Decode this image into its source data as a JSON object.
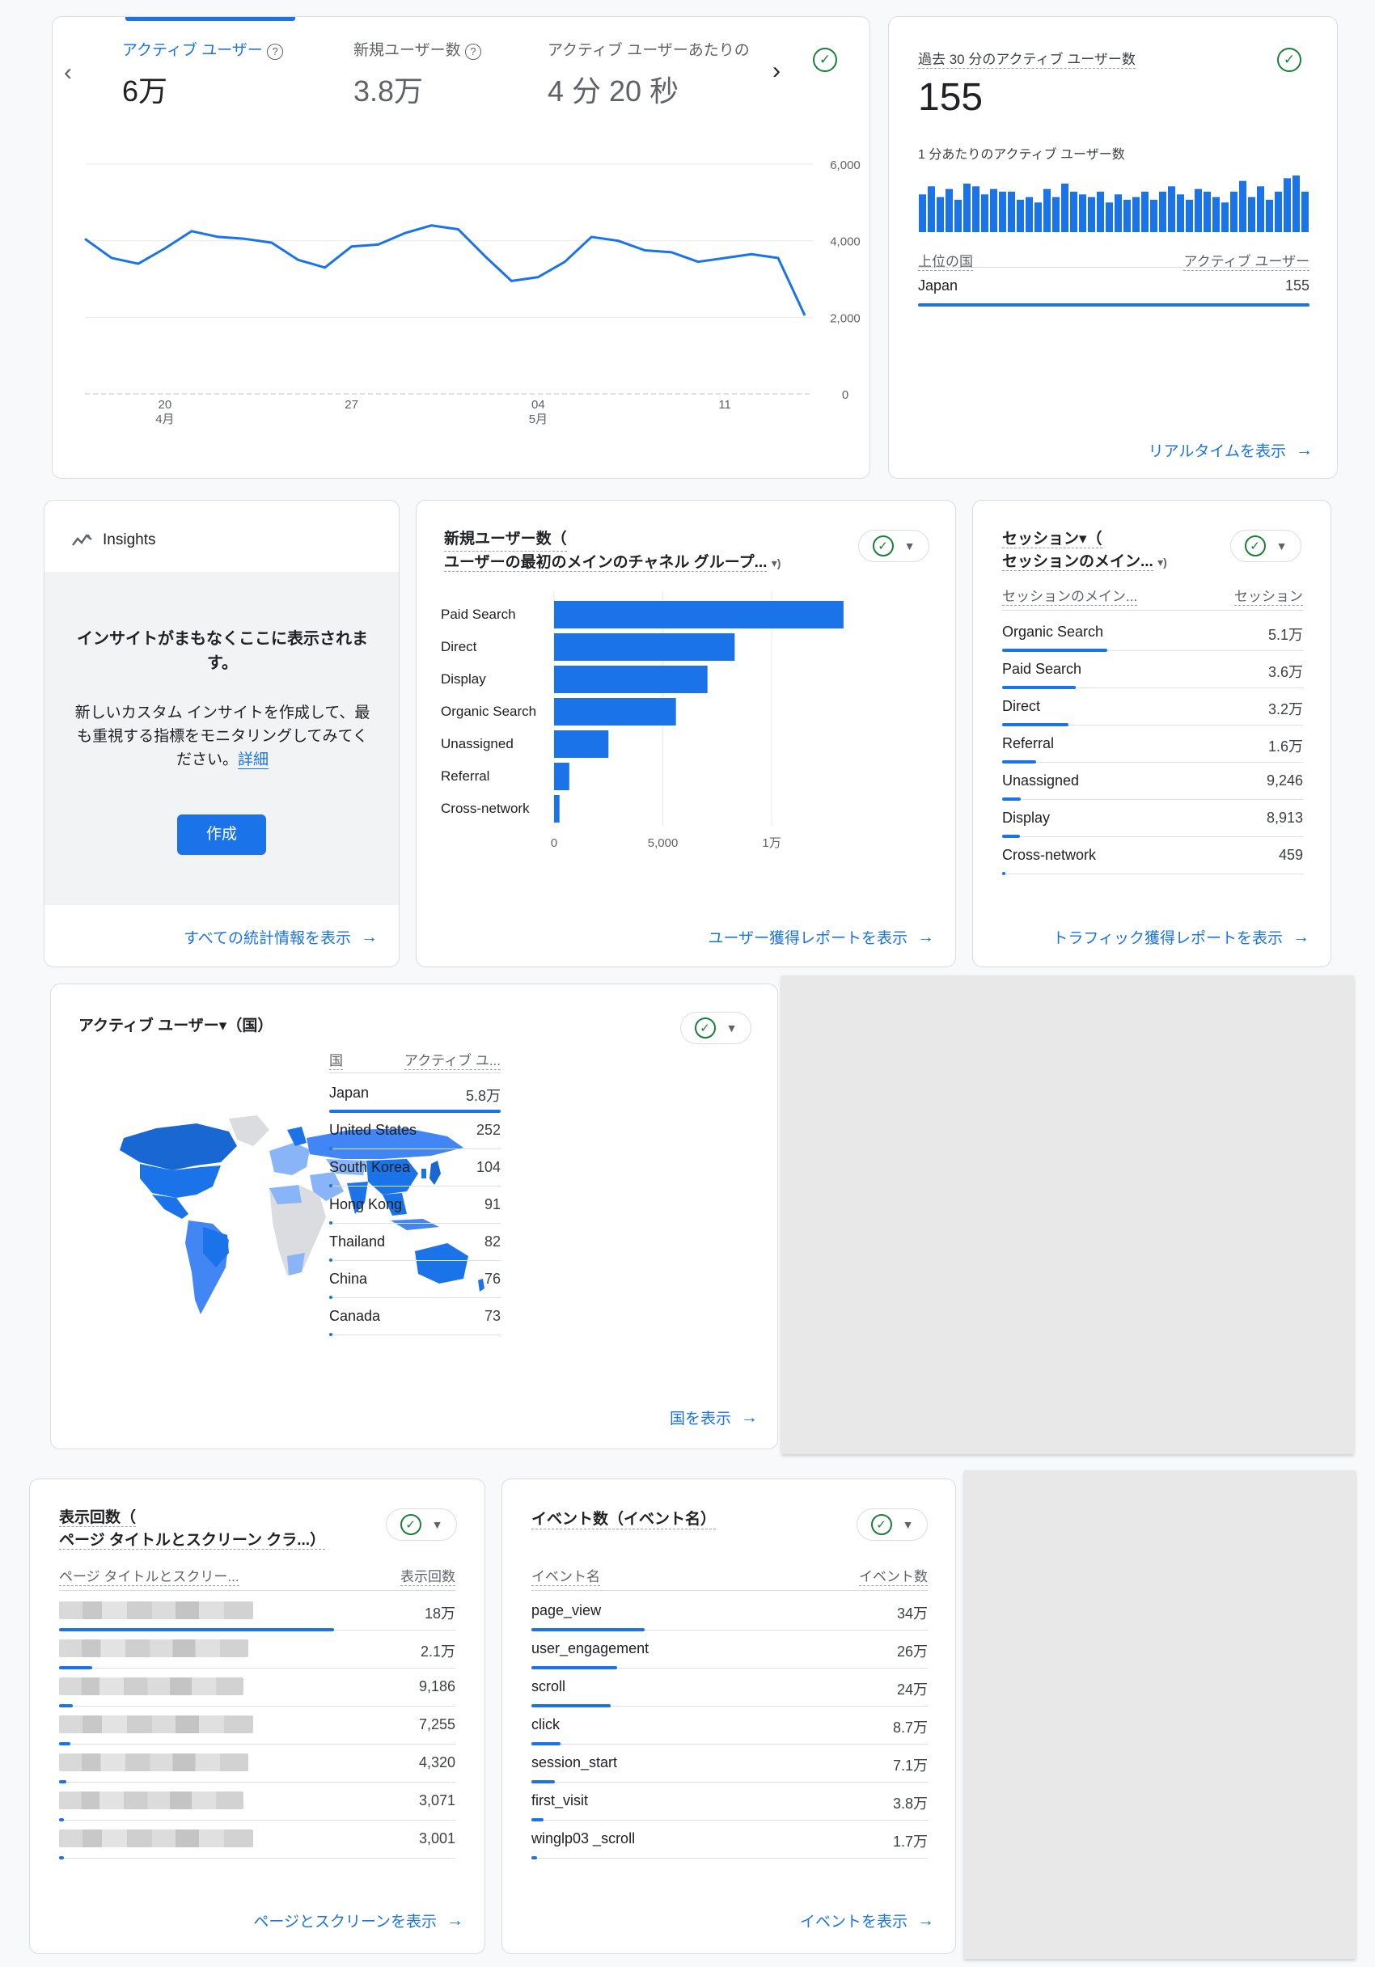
{
  "overview": {
    "metrics": [
      {
        "label": "アクティブ ユーザー",
        "value": "6万",
        "selected": true
      },
      {
        "label": "新規ユーザー数",
        "value": "3.8万",
        "selected": false
      },
      {
        "label": "アクティブ ユーザーあたりの",
        "value": "4 分 20 秒",
        "selected": false
      }
    ],
    "y_ticks": [
      "6,000",
      "4,000",
      "2,000",
      "0"
    ],
    "x_ticks": [
      {
        "day": "20",
        "month": "4月"
      },
      {
        "day": "27",
        "month": ""
      },
      {
        "day": "04",
        "month": "5月"
      },
      {
        "day": "11",
        "month": ""
      }
    ]
  },
  "chart_data": {
    "type": "line",
    "title": "",
    "ylim": [
      0,
      6000
    ],
    "grid": true,
    "x": [
      1,
      2,
      3,
      4,
      5,
      6,
      7,
      8,
      9,
      10,
      11,
      12,
      13,
      14,
      15,
      16,
      17,
      18,
      19,
      20,
      21,
      22,
      23,
      24,
      25,
      26,
      27,
      28
    ],
    "values": [
      4050,
      3550,
      3400,
      3800,
      4250,
      4100,
      4050,
      3950,
      3500,
      3300,
      3850,
      3900,
      4200,
      4400,
      4300,
      3600,
      2950,
      3050,
      3450,
      4100,
      4000,
      3750,
      3700,
      3450,
      3550,
      3650,
      3550,
      2050
    ]
  },
  "realtime": {
    "title": "過去 30 分のアクティブ ユーザー数",
    "count": "155",
    "subtitle": "1 分あたりのアクティブ ユーザー数",
    "minute_values": [
      14,
      17,
      13,
      16,
      12,
      18,
      17,
      14,
      16,
      15,
      15,
      12,
      13,
      11,
      16,
      13,
      18,
      15,
      14,
      13,
      15,
      11,
      14,
      12,
      13,
      15,
      12,
      15,
      17,
      14,
      12,
      16,
      15,
      13,
      11,
      15,
      19,
      13,
      17,
      12,
      15,
      20,
      21,
      15
    ],
    "col_country": "上位の国",
    "col_users": "アクティブ ユーザー",
    "rows": [
      {
        "country": "Japan",
        "value": "155"
      }
    ],
    "link": "リアルタイムを表示"
  },
  "insights": {
    "title": "Insights",
    "message": "インサイトがまもなくここに表示されます。",
    "description": "新しいカスタム インサイトを作成して、最も重視する指標をモニタリングしてみてください。",
    "detail_link": "詳細",
    "create_button": "作成",
    "link": "すべての統計情報を表示"
  },
  "new_users": {
    "title_line1": "新規ユーザー数（",
    "title_line2": "ユーザーの最初のメインのチャネル グループ...",
    "chart_data": {
      "type": "bar",
      "categories": [
        "Paid Search",
        "Direct",
        "Display",
        "Organic Search",
        "Unassigned",
        "Referral",
        "Cross-network"
      ],
      "values": [
        13300,
        8300,
        7050,
        5600,
        2500,
        700,
        250
      ],
      "xlim": [
        0,
        15000
      ]
    },
    "x_ticks": [
      "0",
      "5,000",
      "1万"
    ],
    "link": "ユーザー獲得レポートを表示"
  },
  "sessions": {
    "title_line1": "セッション▾（",
    "title_line2": "セッションのメイン...",
    "col_label": "セッションのメイン...",
    "col_value": "セッション",
    "rows": [
      {
        "label": "Organic Search",
        "value": "5.1万",
        "bar": 1.0
      },
      {
        "label": "Paid Search",
        "value": "3.6万",
        "bar": 0.7
      },
      {
        "label": "Direct",
        "value": "3.2万",
        "bar": 0.63
      },
      {
        "label": "Referral",
        "value": "1.6万",
        "bar": 0.32
      },
      {
        "label": "Unassigned",
        "value": "9,246",
        "bar": 0.18
      },
      {
        "label": "Display",
        "value": "8,913",
        "bar": 0.17
      },
      {
        "label": "Cross-network",
        "value": "459",
        "bar": 0.01
      }
    ],
    "link": "トラフィック獲得レポートを表示"
  },
  "geo": {
    "title": "アクティブ ユーザー▾（国）",
    "col_label": "国",
    "col_value": "アクティブ ユ...",
    "rows": [
      {
        "label": "Japan",
        "value": "5.8万",
        "bar": 1.0
      },
      {
        "label": "United States",
        "value": "252",
        "bar": 0.005
      },
      {
        "label": "South Korea",
        "value": "104",
        "bar": 0.003
      },
      {
        "label": "Hong Kong",
        "value": "91",
        "bar": 0.003
      },
      {
        "label": "Thailand",
        "value": "82",
        "bar": 0.002
      },
      {
        "label": "China",
        "value": "76",
        "bar": 0.002
      },
      {
        "label": "Canada",
        "value": "73",
        "bar": 0.002
      }
    ],
    "link": "国を表示"
  },
  "pageviews": {
    "title_line1": "表示回数（",
    "title_line2": "ページ タイトルとスクリーン クラ...）",
    "col_label": "ページ タイトルとスクリー...",
    "col_value": "表示回数",
    "rows": [
      {
        "value": "18万",
        "bar": 1.0
      },
      {
        "value": "2.1万",
        "bar": 0.12
      },
      {
        "value": "9,186",
        "bar": 0.05
      },
      {
        "value": "7,255",
        "bar": 0.04
      },
      {
        "value": "4,320",
        "bar": 0.025
      },
      {
        "value": "3,071",
        "bar": 0.018
      },
      {
        "value": "3,001",
        "bar": 0.017
      }
    ],
    "link": "ページとスクリーンを表示"
  },
  "events": {
    "title": "イベント数（イベント名）",
    "col_label": "イベント名",
    "col_value": "イベント数",
    "rows": [
      {
        "label": "page_view",
        "value": "34万",
        "bar": 1.0
      },
      {
        "label": "user_engagement",
        "value": "26万",
        "bar": 0.76
      },
      {
        "label": "scroll",
        "value": "24万",
        "bar": 0.7
      },
      {
        "label": "click",
        "value": "8.7万",
        "bar": 0.26
      },
      {
        "label": "session_start",
        "value": "7.1万",
        "bar": 0.21
      },
      {
        "label": "first_visit",
        "value": "3.8万",
        "bar": 0.11
      },
      {
        "label": "winglp03 _scroll",
        "value": "1.7万",
        "bar": 0.05
      }
    ],
    "link": "イベントを表示"
  }
}
